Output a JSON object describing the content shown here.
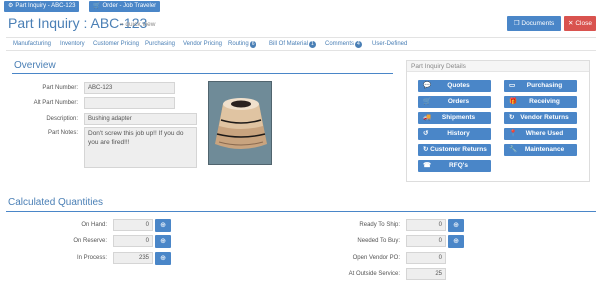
{
  "top_tabs": [
    {
      "label": "Part Inquiry - ABC-123",
      "icon": "gear-icon"
    },
    {
      "label": "Order - Job Traveler",
      "icon": "cart-icon"
    }
  ],
  "header": {
    "title": "Part Inquiry : ABC-123",
    "subtitle": "quick view",
    "documents_label": "Documents",
    "close_label": "Close"
  },
  "subnav": [
    {
      "label": "Manufacturing"
    },
    {
      "label": "Inventory"
    },
    {
      "label": "Customer Pricing"
    },
    {
      "label": "Purchasing"
    },
    {
      "label": "Vendor Pricing"
    },
    {
      "label": "Routing",
      "badge": "6"
    },
    {
      "label": "Bill Of Material",
      "badge": "1"
    },
    {
      "label": "Comments",
      "badge": "4"
    },
    {
      "label": "User-Defined"
    }
  ],
  "overview": {
    "title": "Overview",
    "part_number_label": "Part Number:",
    "part_number_value": "ABC-123",
    "alt_part_number_label": "Alt Part Number:",
    "alt_part_number_value": "",
    "description_label": "Description:",
    "description_value": "Bushing adapter",
    "part_notes_label": "Part Notes:",
    "part_notes_value": "Don't screw this job up!! If you do you are fired!!!"
  },
  "details_panel": {
    "title": "Part Inquiry Details",
    "buttons": [
      {
        "label": "Quotes",
        "icon": "comments-icon"
      },
      {
        "label": "Purchasing",
        "icon": "credit-card-icon"
      },
      {
        "label": "Orders",
        "icon": "cart-icon"
      },
      {
        "label": "Receiving",
        "icon": "gift-icon"
      },
      {
        "label": "Shipments",
        "icon": "truck-icon"
      },
      {
        "label": "Vendor Returns",
        "icon": "refresh-icon"
      },
      {
        "label": "History",
        "icon": "history-icon"
      },
      {
        "label": "Where Used",
        "icon": "map-marker-icon"
      },
      {
        "label": "Customer Returns",
        "icon": "refresh-icon"
      },
      {
        "label": "Maintenance",
        "icon": "wrench-icon"
      },
      {
        "label": "RFQ's",
        "icon": "phone-icon"
      }
    ]
  },
  "quantities": {
    "title": "Calculated Quantities",
    "on_hand_label": "On Hand:",
    "on_hand": "0",
    "on_reserve_label": "On Reserve:",
    "on_reserve": "0",
    "in_process_label": "In Process:",
    "in_process": "235",
    "ready_to_ship_label": "Ready To Ship:",
    "ready_to_ship": "0",
    "needed_to_buy_label": "Needed To Buy:",
    "needed_to_buy": "0",
    "open_vendor_po_label": "Open Vendor PO:",
    "open_vendor_po": "0",
    "at_outside_service_label": "At Outside Service:",
    "at_outside_service": "25"
  },
  "colors": {
    "accent": "#4a86c8",
    "danger": "#d9534f",
    "title": "#4a7fb5"
  }
}
